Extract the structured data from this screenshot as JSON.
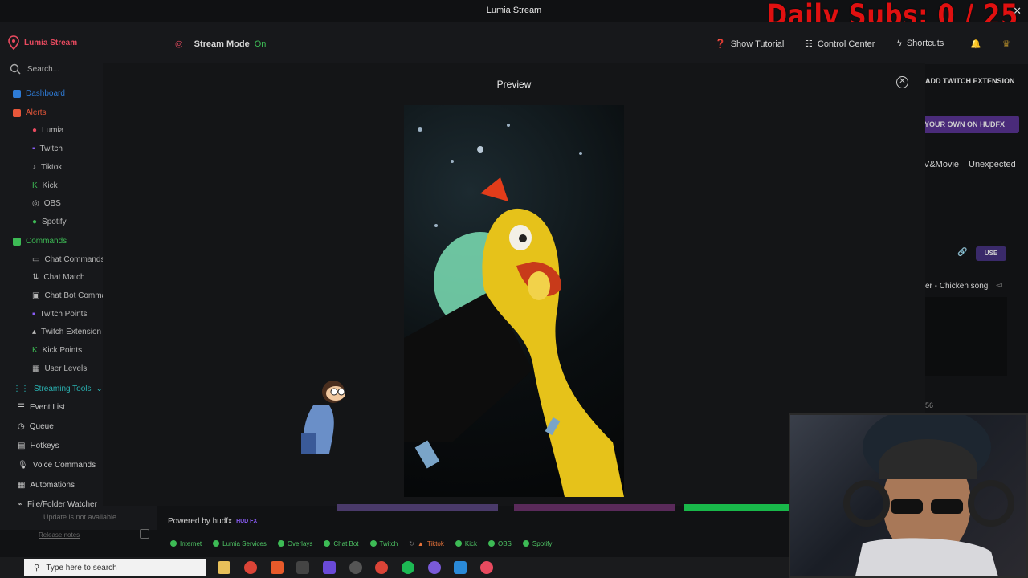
{
  "window": {
    "title": "Lumia Stream"
  },
  "overlay_text": "Daily Subs: 0 / 25",
  "sidebar": {
    "brand": "Lumia Stream",
    "search_placeholder": "Search...",
    "items": [
      {
        "label": "Dashboard",
        "icon": "dashboard-icon",
        "color": "#2e7bd6"
      },
      {
        "label": "Alerts",
        "icon": "alert-icon",
        "color": "#e8573a"
      },
      {
        "label": "Lumia",
        "icon": "lumia-icon"
      },
      {
        "label": "Twitch",
        "icon": "twitch-icon"
      },
      {
        "label": "Tiktok",
        "icon": "tiktok-icon"
      },
      {
        "label": "Kick",
        "icon": "kick-icon"
      },
      {
        "label": "OBS",
        "icon": "obs-icon"
      },
      {
        "label": "Spotify",
        "icon": "spotify-icon"
      },
      {
        "label": "Commands",
        "icon": "commands-icon",
        "color": "#3dbb55"
      },
      {
        "label": "Chat Commands",
        "icon": "chat-icon"
      },
      {
        "label": "Chat Match",
        "icon": "match-icon"
      },
      {
        "label": "Chat Bot Comma",
        "icon": "bot-icon"
      },
      {
        "label": "Twitch Points",
        "icon": "twitch-icon"
      },
      {
        "label": "Twitch Extension",
        "icon": "extension-icon"
      },
      {
        "label": "Kick Points",
        "icon": "kick-icon"
      },
      {
        "label": "User Levels",
        "icon": "levels-icon"
      },
      {
        "label": "Streaming Tools",
        "icon": "tools-icon",
        "color": "#2ab3b3"
      },
      {
        "label": "Event List",
        "icon": "list-icon"
      },
      {
        "label": "Queue",
        "icon": "queue-icon"
      },
      {
        "label": "Hotkeys",
        "icon": "hotkeys-icon"
      },
      {
        "label": "Voice Commands",
        "icon": "mic-icon"
      },
      {
        "label": "Automations",
        "icon": "automation-icon"
      },
      {
        "label": "File/Folder Watcher",
        "icon": "folder-icon"
      }
    ],
    "update_status": "Update is not available",
    "release_notes": "Release notes"
  },
  "header": {
    "stream_mode_label": "Stream Mode",
    "stream_mode_value": "On",
    "show_tutorial": "Show Tutorial",
    "control_center": "Control Center",
    "shortcuts": "Shortcuts"
  },
  "modal": {
    "title": "Preview"
  },
  "right_panel": {
    "add_extension": "ADD TWITCH EXTENSION",
    "your_own": "YOUR OWN ON HUDFX",
    "tag_movie": "V&Movie",
    "tag_unexpected": "Unexpected",
    "use_button": "USE",
    "song": "er - Chicken song",
    "count": "56"
  },
  "footer": {
    "powered_by": "Powered by hudfx",
    "hud_badge": "HUD FX"
  },
  "status": [
    {
      "label": "Internet",
      "color": "#3dbb55"
    },
    {
      "label": "Lumia Services",
      "color": "#3dbb55"
    },
    {
      "label": "Overlays",
      "color": "#3dbb55"
    },
    {
      "label": "Chat Bot",
      "color": "#3dbb55"
    },
    {
      "label": "Twitch",
      "color": "#3dbb55"
    },
    {
      "label": "Tiktok",
      "color": "#e8733a"
    },
    {
      "label": "Kick",
      "color": "#3dbb55"
    },
    {
      "label": "OBS",
      "color": "#3dbb55"
    },
    {
      "label": "Spotify",
      "color": "#3dbb55"
    }
  ],
  "taskbar": {
    "search_placeholder": "Type here to search"
  }
}
